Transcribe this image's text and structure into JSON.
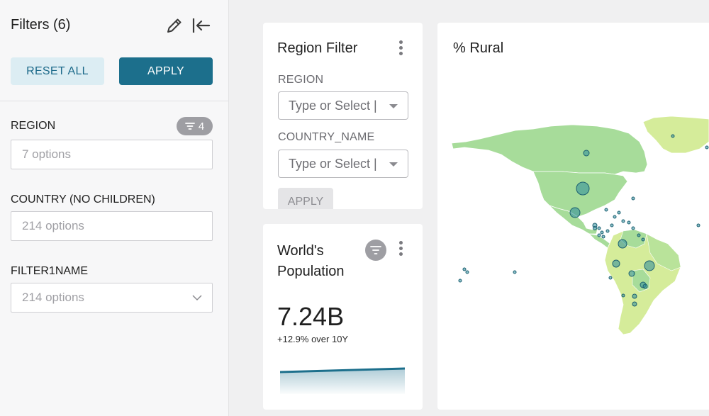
{
  "sidebar": {
    "title": "Filters (6)",
    "reset_label": "RESET ALL",
    "apply_label": "APPLY",
    "filters": [
      {
        "label": "REGION",
        "placeholder": "7 options",
        "badge": "4"
      },
      {
        "label": "COUNTRY (NO CHILDREN)",
        "placeholder": "214 options"
      },
      {
        "label": "FILTER1NAME",
        "placeholder": "214 options"
      }
    ]
  },
  "region_filter": {
    "title": "Region Filter",
    "fields": [
      {
        "label": "REGION",
        "placeholder": "Type or Select |"
      },
      {
        "label": "COUNTRY_NAME",
        "placeholder": "Type or Select |"
      }
    ],
    "apply_label": "APPLY"
  },
  "population": {
    "title_line1": "World's",
    "title_line2": "Population",
    "value": "7.24B",
    "change": "+12.9% over 10Y"
  },
  "rural_map": {
    "title": "% Rural"
  },
  "colors": {
    "accent": "#1c6f8c",
    "reset_bg": "#dcedf3",
    "badge": "#9e9ea3",
    "map_light": "#d5ec9a",
    "map_mid": "#a7dc9a",
    "bubble": "#2a8a9a"
  },
  "icons": {
    "edit": "pencil-icon",
    "collapse": "collapse-left-icon",
    "filter": "filter-icon",
    "more": "kebab-icon",
    "chevron": "chevron-down-icon"
  }
}
